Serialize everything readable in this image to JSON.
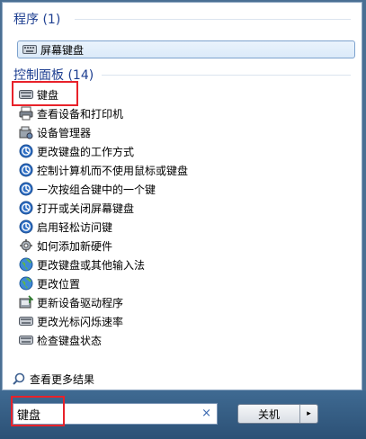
{
  "programs": {
    "title": "程序 (1)",
    "items": [
      {
        "label": "屏幕键盘",
        "icon": "keyboard-icon"
      }
    ]
  },
  "control_panel": {
    "title": "控制面板 (14)",
    "items": [
      {
        "label": "键盘",
        "icon": "keyboard-icon"
      },
      {
        "label": "查看设备和打印机",
        "icon": "printer-icon"
      },
      {
        "label": "设备管理器",
        "icon": "device-manager-icon"
      },
      {
        "label": "更改键盘的工作方式",
        "icon": "ease-of-access-icon"
      },
      {
        "label": "控制计算机而不使用鼠标或键盘",
        "icon": "ease-of-access-icon"
      },
      {
        "label": "一次按组合键中的一个键",
        "icon": "ease-of-access-icon"
      },
      {
        "label": "打开或关闭屏幕键盘",
        "icon": "ease-of-access-icon"
      },
      {
        "label": "启用轻松访问键",
        "icon": "ease-of-access-icon"
      },
      {
        "label": "如何添加新硬件",
        "icon": "hardware-icon"
      },
      {
        "label": "更改键盘或其他输入法",
        "icon": "globe-icon"
      },
      {
        "label": "更改位置",
        "icon": "globe-icon"
      },
      {
        "label": "更新设备驱动程序",
        "icon": "driver-icon"
      },
      {
        "label": "更改光标闪烁速率",
        "icon": "keyboard-icon"
      },
      {
        "label": "检查键盘状态",
        "icon": "keyboard-icon"
      }
    ]
  },
  "more_results": "查看更多结果",
  "search": {
    "value": "键盘",
    "clear": "×"
  },
  "shutdown": {
    "label": "关机",
    "arrow": "▸"
  },
  "colors": {
    "highlight_box": "#e8222a",
    "section_title": "#1e3f91"
  }
}
